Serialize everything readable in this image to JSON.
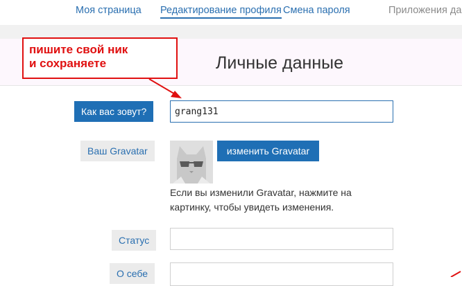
{
  "nav": {
    "items": [
      {
        "label": "Моя страница"
      },
      {
        "label": "Редактирование профиля"
      },
      {
        "label": "Смена пароля"
      },
      {
        "label": "Приложения да"
      }
    ]
  },
  "page": {
    "title": "Личные данные"
  },
  "annotation": {
    "text": "пишите свой ник\nи сохраняете"
  },
  "form": {
    "name_label": "Как вас зовут?",
    "name_value": "grang131",
    "gravatar_label": "Ваш Gravatar",
    "gravatar_button": "изменить Gravatar",
    "gravatar_hint": "Если вы изменили Gravatar, нажмите на картинку, чтобы увидеть изменения.",
    "status_label": "Статус",
    "status_value": "",
    "about_label": "О себе",
    "about_value": ""
  },
  "colors": {
    "accent": "#1f6fb5",
    "annotation_red": "#e01010"
  },
  "icons": {
    "avatar": "cat-with-sunglasses-icon"
  }
}
